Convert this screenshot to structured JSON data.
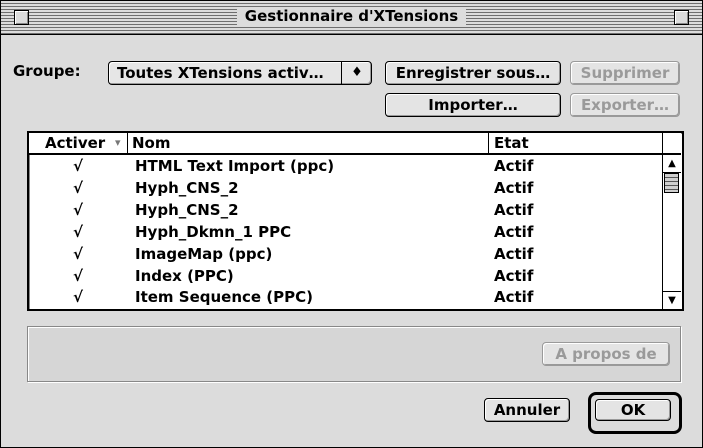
{
  "window": {
    "title": "Gestionnaire d'XTensions"
  },
  "group": {
    "label": "Groupe:",
    "selected": "Toutes XTensions activ…",
    "arrow": "♦"
  },
  "buttons": {
    "save_as": "Enregistrer sous…",
    "delete": "Supprimer",
    "import": "Importer…",
    "export": "Exporter…",
    "about": "A propos de",
    "cancel": "Annuler",
    "ok": "OK"
  },
  "table": {
    "columns": {
      "enable": "Activer",
      "sort_indicator": "▾",
      "name": "Nom",
      "state": "Etat"
    },
    "rows": [
      {
        "check": "√",
        "name": "HTML Text Import (ppc)",
        "state": "Actif"
      },
      {
        "check": "√",
        "name": "Hyph_CNS_2",
        "state": "Actif"
      },
      {
        "check": "√",
        "name": "Hyph_CNS_2",
        "state": "Actif"
      },
      {
        "check": "√",
        "name": "Hyph_Dkmn_1 PPC",
        "state": "Actif"
      },
      {
        "check": "√",
        "name": "ImageMap (ppc)",
        "state": "Actif"
      },
      {
        "check": "√",
        "name": "Index (PPC)",
        "state": "Actif"
      },
      {
        "check": "√",
        "name": "Item Sequence (PPC)",
        "state": "Actif"
      }
    ]
  },
  "scrollbar": {
    "up": "▲",
    "down": "▼"
  }
}
